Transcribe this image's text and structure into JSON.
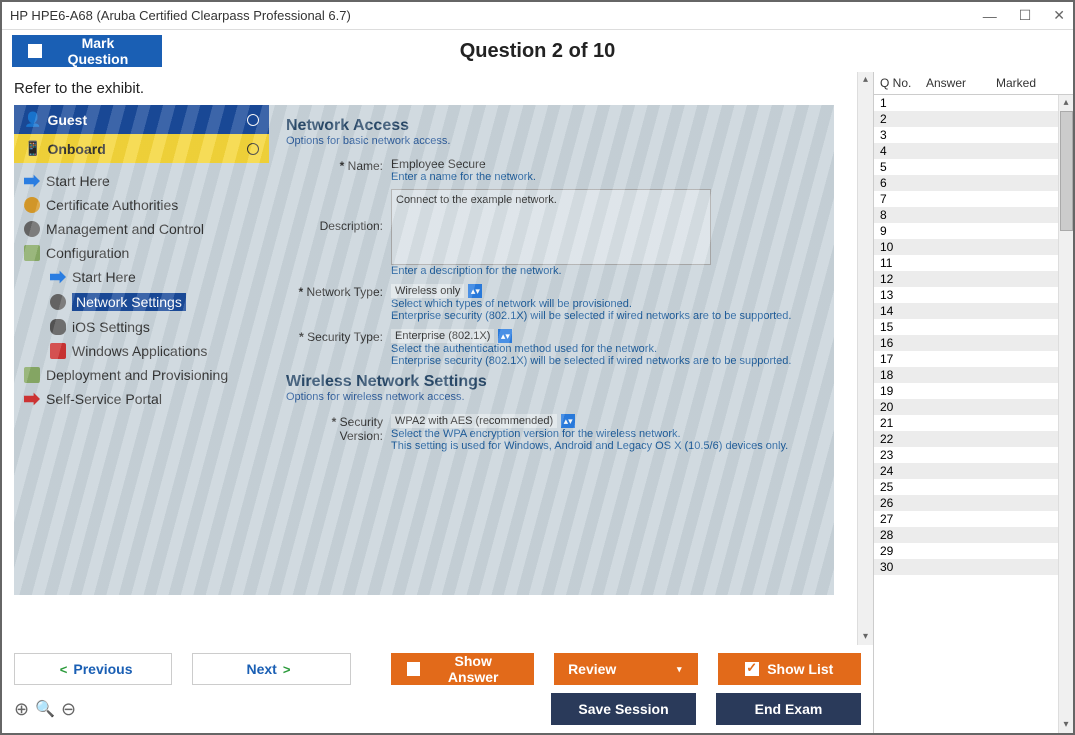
{
  "window": {
    "title": "HP HPE6-A68 (Aruba Certified Clearpass Professional 6.7)"
  },
  "toolbar": {
    "mark_question": "Mark Question",
    "question_counter": "Question 2 of 10"
  },
  "question": {
    "prompt": "Refer to the exhibit."
  },
  "exhibit": {
    "tabs": {
      "guest": "Guest",
      "onboard": "Onboard"
    },
    "nav": {
      "start_here": "Start Here",
      "cert_auth": "Certificate Authorities",
      "mgmt": "Management and Control",
      "config": "Configuration",
      "config_start": "Start Here",
      "config_net": "Network Settings",
      "config_ios": "iOS Settings",
      "config_win": "Windows Applications",
      "deploy": "Deployment and Provisioning",
      "self_serv": "Self-Service Portal"
    },
    "form": {
      "section1_title": "Network Access",
      "section1_sub": "Options for basic network access.",
      "name_label": "Name:",
      "name_value": "Employee Secure",
      "name_hint": "Enter a name for the network.",
      "desc_label": "Description:",
      "desc_value": "Connect to the example network.",
      "desc_hint": "Enter a description for the network.",
      "nettype_label": "Network Type:",
      "nettype_value": "Wireless only",
      "nettype_hint1": "Select which types of network will be provisioned.",
      "nettype_hint2": "Enterprise security (802.1X) will be selected if wired networks are to be supported.",
      "sectype_label": "Security Type:",
      "sectype_value": "Enterprise (802.1X)",
      "sectype_hint1": "Select the authentication method used for the network.",
      "sectype_hint2": "Enterprise security (802.1X) will be selected if wired networks are to be supported.",
      "section2_title": "Wireless Network Settings",
      "section2_sub": "Options for wireless network access.",
      "secver_label": "Security Version:",
      "secver_value": "WPA2 with AES (recommended)",
      "secver_hint1": "Select the WPA encryption version for the wireless network.",
      "secver_hint2": "This setting is used for Windows, Android and Legacy OS X (10.5/6) devices only."
    }
  },
  "qlist": {
    "headers": [
      "Q No.",
      "Answer",
      "Marked"
    ],
    "count": 30
  },
  "nav_buttons": {
    "previous": "Previous",
    "next": "Next",
    "show_answer": "Show Answer",
    "review": "Review",
    "show_list": "Show List",
    "save_session": "Save Session",
    "end_exam": "End Exam"
  }
}
